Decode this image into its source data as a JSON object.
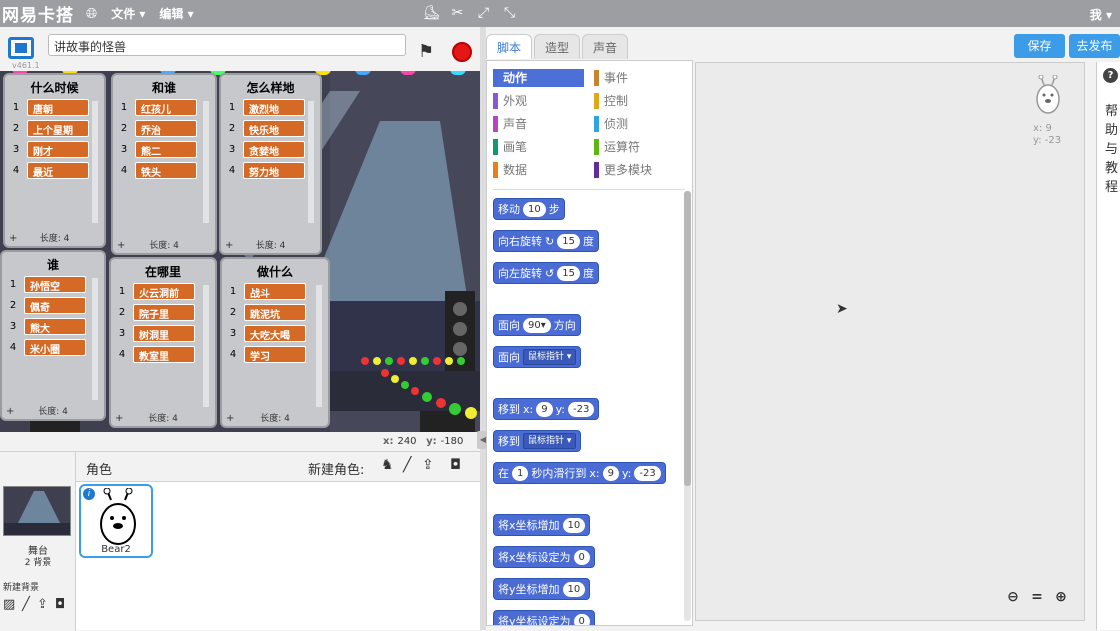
{
  "topbar": {
    "logo": "网易卡搭",
    "menu_file": "文件",
    "menu_edit": "编辑",
    "user": "我"
  },
  "stage_header": {
    "version": "v461.1",
    "project_title": "讲故事的怪兽"
  },
  "lists": [
    {
      "title": "什么时候",
      "items": [
        "唐朝",
        "上个星期",
        "刚才",
        "最近"
      ],
      "length_label": "长度: 4"
    },
    {
      "title": "和谁",
      "items": [
        "红孩儿",
        "乔治",
        "熊二",
        "铁头"
      ],
      "length_label": "长度: 4"
    },
    {
      "title": "怎么样地",
      "items": [
        "激烈地",
        "快乐地",
        "贪婪地",
        "努力地"
      ],
      "length_label": "长度: 4"
    },
    {
      "title": "谁",
      "items": [
        "孙悟空",
        "佩奇",
        "熊大",
        "米小圈"
      ],
      "length_label": "长度: 4"
    },
    {
      "title": "在哪里",
      "items": [
        "火云洞前",
        "院子里",
        "树洞里",
        "教室里"
      ],
      "length_label": "长度: 4"
    },
    {
      "title": "做什么",
      "items": [
        "战斗",
        "跳泥坑",
        "大吃大喝",
        "学习"
      ],
      "length_label": "长度: 4"
    }
  ],
  "coords": {
    "x_label": "x:",
    "x": "240",
    "y_label": "y:",
    "y": "-180"
  },
  "sprites_panel": {
    "title": "角色",
    "new_sprite": "新建角色:",
    "stage_name": "舞台",
    "stage_bg_count": "2 背景",
    "new_background": "新建背景",
    "sprite_name": "Bear2"
  },
  "tabs": [
    "脚本",
    "造型",
    "声音"
  ],
  "buttons": {
    "save": "保存",
    "share": "去发布"
  },
  "categories": [
    {
      "label": "动作",
      "color": "#4a6cd4"
    },
    {
      "label": "事件",
      "color": "#c88330"
    },
    {
      "label": "外观",
      "color": "#8a55d7"
    },
    {
      "label": "控制",
      "color": "#e1a91a"
    },
    {
      "label": "声音",
      "color": "#bb42c3"
    },
    {
      "label": "侦测",
      "color": "#2ca5e2"
    },
    {
      "label": "画笔",
      "color": "#0e9a6c"
    },
    {
      "label": "运算符",
      "color": "#5cb712"
    },
    {
      "label": "数据",
      "color": "#ee7d16"
    },
    {
      "label": "更多模块",
      "color": "#632d99"
    }
  ],
  "blocks": {
    "move": {
      "a": "移动",
      "v": "10",
      "b": "步"
    },
    "turn_right": {
      "a": "向右旋转",
      "v": "15",
      "b": "度"
    },
    "turn_left": {
      "a": "向左旋转",
      "v": "15",
      "b": "度"
    },
    "point_dir": {
      "a": "面向",
      "v": "90▾",
      "b": "方向"
    },
    "point_to": {
      "a": "面向",
      "d": "鼠标指针"
    },
    "goto_xy": {
      "a": "移到",
      "xl": "x:",
      "x": "9",
      "yl": "y:",
      "y": "-23"
    },
    "goto": {
      "a": "移到",
      "d": "鼠标指针"
    },
    "glide": {
      "a": "在",
      "v": "1",
      "b": "秒内滑行到",
      "xl": "x:",
      "x": "9",
      "yl": "y:",
      "y": "-23"
    },
    "change_x": {
      "a": "将x坐标增加",
      "v": "10"
    },
    "set_x": {
      "a": "将x坐标设定为",
      "v": "0"
    },
    "change_y": {
      "a": "将y坐标增加",
      "v": "10"
    },
    "set_y": {
      "a": "将y坐标设定为",
      "v": "0"
    }
  },
  "script_area": {
    "x_readout": "x: 9",
    "y_readout": "y: -23"
  },
  "help": {
    "text": "帮助与教程"
  }
}
